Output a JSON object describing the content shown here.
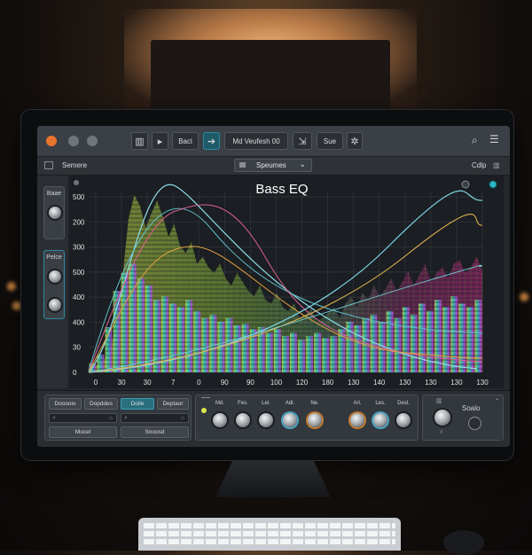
{
  "toolbar": {
    "buttons": [
      {
        "label": "Bacl"
      },
      {
        "label": "Md  Veufesh 00"
      },
      {
        "label": "Sue"
      }
    ]
  },
  "subbar": {
    "left_label": "Semere",
    "dropdown_value": "Speumes",
    "right_label": "Cdlp"
  },
  "side_panel": {
    "top_label": "Baae",
    "bottom_label": "Pelce"
  },
  "graph": {
    "title": "Bass EQ"
  },
  "chart_data": {
    "type": "bar",
    "title": "Bass EQ",
    "y_tick_labels": [
      "500",
      "200",
      "300",
      "500",
      "400",
      "400",
      "30",
      "0"
    ],
    "x_tick_labels": [
      "0",
      "30",
      "30",
      "7",
      "0",
      "90",
      "90",
      "100",
      "120",
      "180",
      "130",
      "140",
      "130",
      "130",
      "130",
      "130"
    ],
    "grid": true,
    "spectrum_levels": [
      0.02,
      0.03,
      0.05,
      0.08,
      0.15,
      0.3,
      0.55,
      0.85,
      0.98,
      0.92,
      0.8,
      0.88,
      0.95,
      0.86,
      0.75,
      0.82,
      0.7,
      0.66,
      0.72,
      0.6,
      0.64,
      0.58,
      0.55,
      0.6,
      0.52,
      0.48,
      0.55,
      0.5,
      0.45,
      0.42,
      0.48,
      0.4,
      0.38,
      0.44,
      0.36,
      0.34,
      0.38,
      0.3,
      0.32,
      0.35,
      0.28,
      0.3,
      0.33,
      0.36,
      0.3,
      0.38,
      0.42,
      0.36,
      0.44,
      0.4,
      0.48,
      0.42,
      0.46,
      0.52,
      0.45,
      0.5,
      0.56,
      0.48,
      0.54,
      0.6,
      0.5,
      0.55,
      0.58,
      0.52,
      0.6,
      0.62,
      0.55,
      0.58,
      0.64,
      0.56
    ],
    "eq_bars": [
      0.05,
      0.1,
      0.25,
      0.45,
      0.55,
      0.6,
      0.52,
      0.48,
      0.4,
      0.42,
      0.38,
      0.36,
      0.4,
      0.34,
      0.3,
      0.32,
      0.28,
      0.3,
      0.26,
      0.27,
      0.24,
      0.25,
      0.22,
      0.24,
      0.2,
      0.22,
      0.18,
      0.2,
      0.22,
      0.19,
      0.2,
      0.24,
      0.28,
      0.26,
      0.3,
      0.32,
      0.28,
      0.34,
      0.3,
      0.36,
      0.32,
      0.38,
      0.34,
      0.4,
      0.36,
      0.42,
      0.38,
      0.36,
      0.4
    ]
  },
  "bottom": {
    "mode_buttons": [
      {
        "label": "Dooooio"
      },
      {
        "label": "Dopddes"
      },
      {
        "label": "Doile"
      },
      {
        "label": "Deptaor"
      }
    ],
    "left_button": "Mocel",
    "right_button": "Snoosd",
    "knob_labels": [
      "Md.",
      "Fes.",
      "Lel.",
      "Adl.",
      "Ne."
    ],
    "knob_labels_right": [
      "Arl.",
      "Les.",
      "Desl."
    ],
    "output_label": "Soalo"
  }
}
